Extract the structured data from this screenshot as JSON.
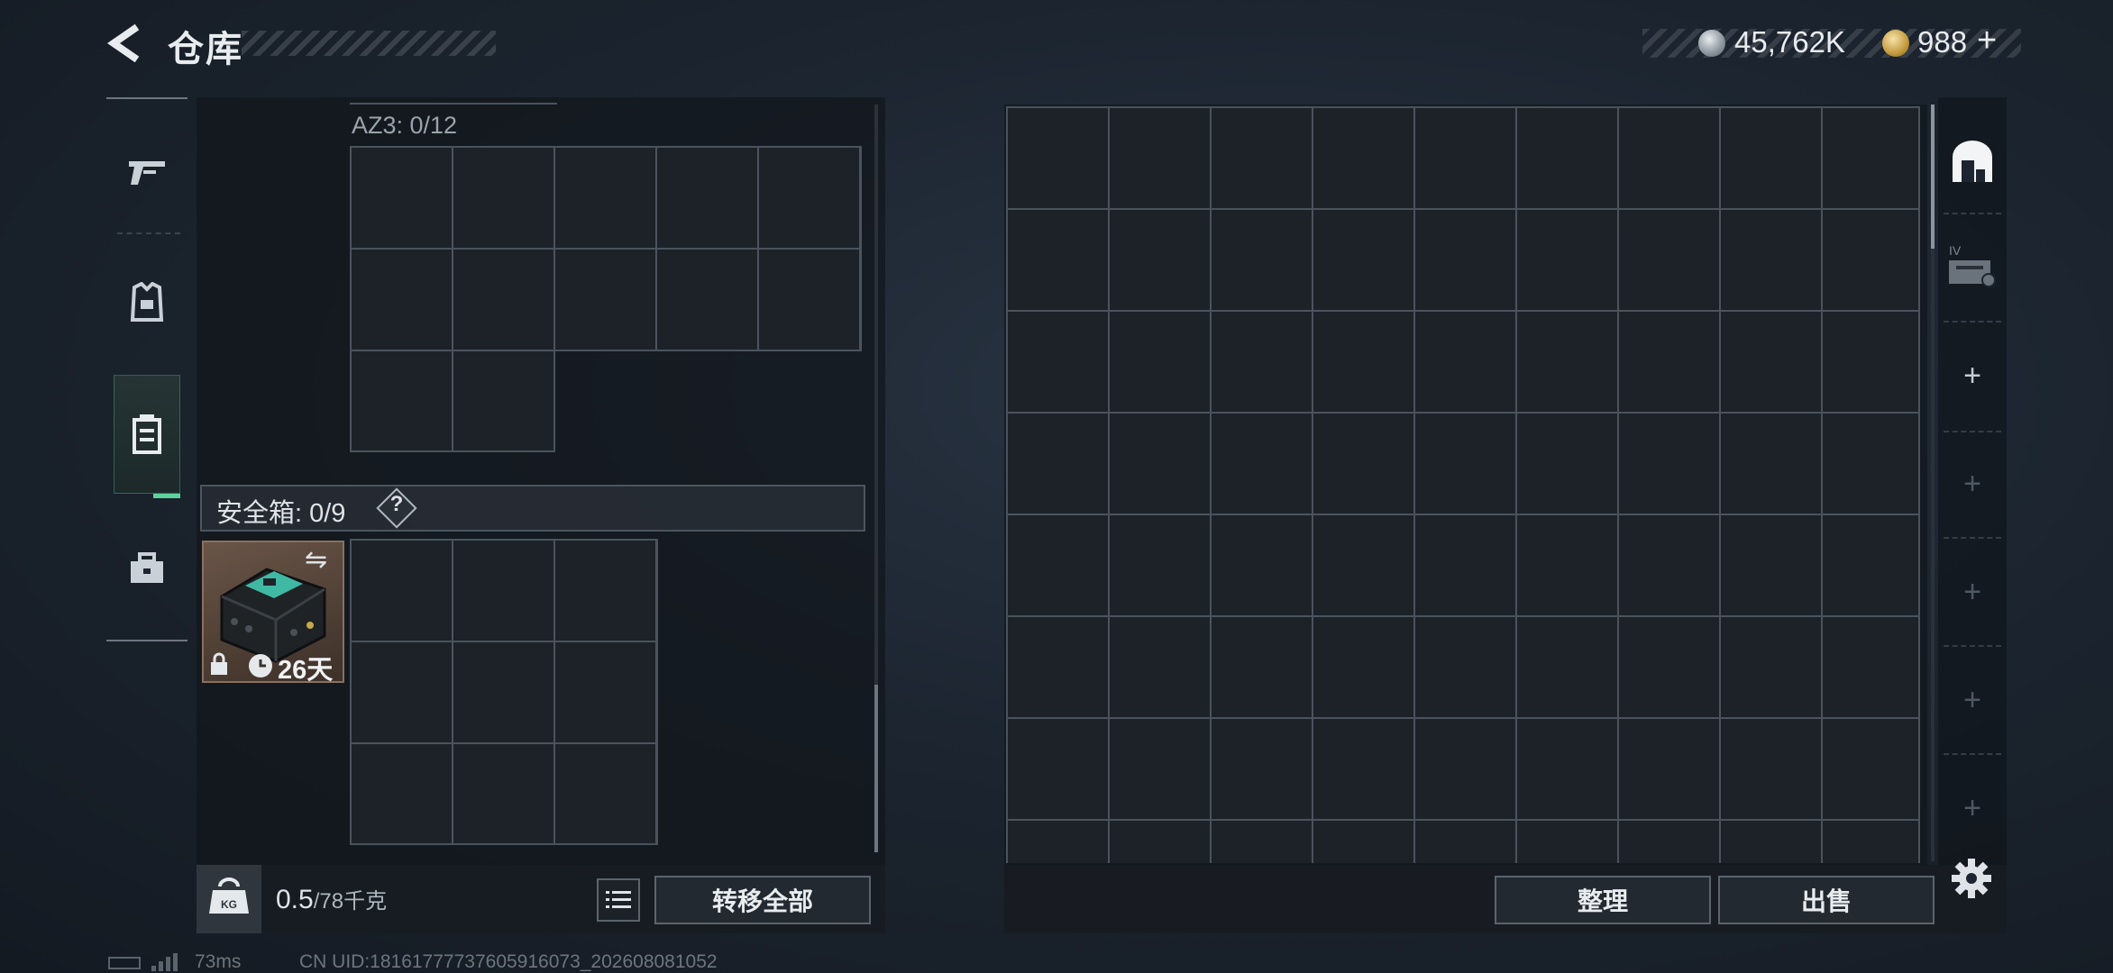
{
  "header": {
    "title": "仓库",
    "currency_silver": "45,762K",
    "currency_gold": "988",
    "plus_label": "+"
  },
  "left_panel": {
    "az_label": "AZ3: 0/12",
    "safe_box_label": "安全箱: 0/9",
    "help_label": "?",
    "item": {
      "remaining_time": "26天"
    },
    "weight_current": "0.5",
    "weight_max": "/78千克",
    "kg_label": "KG",
    "transfer_all_label": "转移全部"
  },
  "right_panel": {
    "sort_label": "整理",
    "sell_label": "出售",
    "tabs": [
      {
        "icon": "storage-home-icon",
        "active": true
      },
      {
        "icon": "container-iv-icon",
        "label": "IV"
      },
      {
        "icon": "add-icon",
        "label": "+"
      },
      {
        "icon": "add-icon",
        "label": "+"
      },
      {
        "icon": "add-icon",
        "label": "+"
      },
      {
        "icon": "add-icon",
        "label": "+"
      },
      {
        "icon": "add-icon",
        "label": "+"
      }
    ]
  },
  "footer": {
    "ping": "73ms",
    "uid": "CN UID:18161777737605916073_202608081052"
  },
  "colors": {
    "accent_green": "#5bd39b",
    "item_bg": "#6a5548",
    "item_teal": "#3fb8a4"
  }
}
